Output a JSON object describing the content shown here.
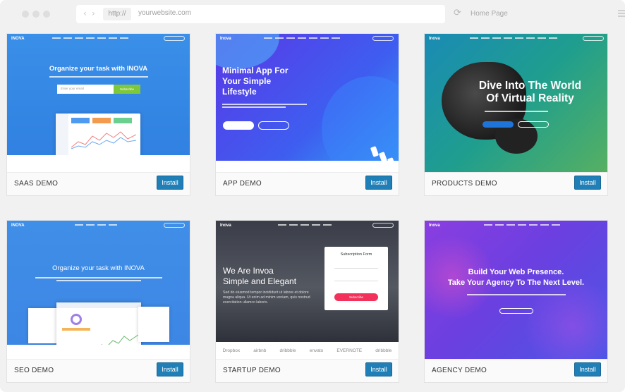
{
  "browser": {
    "protocol": "http://",
    "url": "yourwebsite.com",
    "home_label": "Home Page"
  },
  "cards": [
    {
      "title": "SAAS DEMO",
      "button": "Install",
      "logo": "INOVA",
      "headline": "Organize your task with INOVA",
      "input_placeholder": "Enter your email",
      "cta": "Subscribe"
    },
    {
      "title": "APP DEMO",
      "button": "Install",
      "logo": "Inova",
      "headline_1": "Minimal App For",
      "headline_2": "Your Simple",
      "headline_3": "Lifestyle"
    },
    {
      "title": "PRODUCTS DEMO",
      "button": "Install",
      "logo": "Inova",
      "headline_1": "Dive Into The World",
      "headline_2": "Of Virtual Reality"
    },
    {
      "title": "SEO DEMO",
      "button": "Install",
      "logo": "INOVA",
      "headline": "Organize your task with INOVA"
    },
    {
      "title": "STARTUP DEMO",
      "button": "Install",
      "logo": "Inova",
      "headline_1": "We Are Invoa",
      "headline_2": "Simple and Elegant",
      "body": "Sed do eiusmod tempor incididunt ut labore et dolore magna aliqua. Ut enim ad minim veniam, quis nostrud exercitation ullamco laboris.",
      "form_title": "Subscription Form",
      "form_button": "Subscribe",
      "brands": [
        "Dropbox",
        "airbnb",
        "dribbble",
        "envato",
        "EVERNOTE",
        "dribbble"
      ]
    },
    {
      "title": "AGENCY DEMO",
      "button": "Install",
      "logo": "Inova",
      "headline_1": "Build Your Web Presence.",
      "headline_2": "Take Your Agency To The Next Level."
    }
  ],
  "colors": {
    "install_button": "#1f7fb6",
    "saas_bg": "#3a8fe8",
    "app_bg": "#3b55e6",
    "products_bg": "#1f9e8e",
    "agency_bg": "#7b3fe0"
  }
}
